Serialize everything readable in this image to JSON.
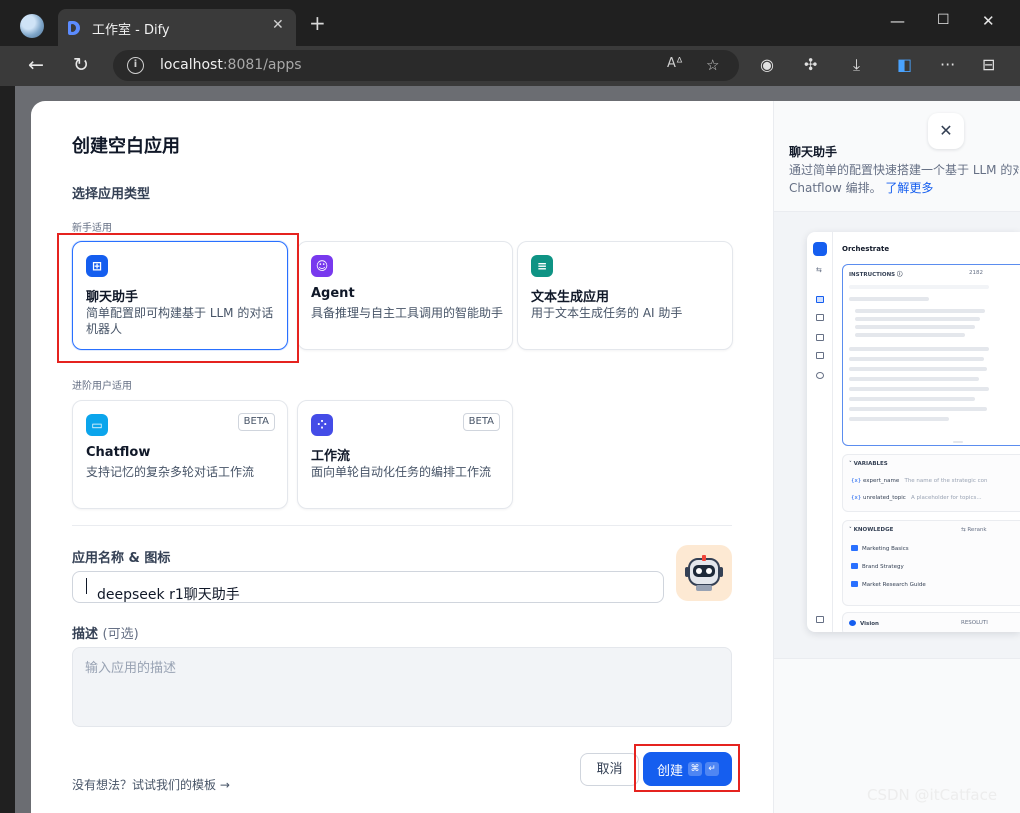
{
  "browser": {
    "tab_title": "工作室 - Dify",
    "tab_close": "✕",
    "new_tab": "+",
    "url_host": "localhost",
    "url_rest": ":8081/apps"
  },
  "modal": {
    "title": "创建空白应用",
    "section_type": "选择应用类型",
    "group_beginner": "新手适用",
    "group_advanced": "进阶用户适用",
    "app_types": [
      {
        "title": "聊天助手",
        "desc": "简单配置即可构建基于 LLM 的对话机器人",
        "icon_color": "#155eef",
        "selected": true
      },
      {
        "title": "Agent",
        "desc": "具备推理与自主工具调用的智能助手",
        "icon_color": "#7839ee",
        "selected": false
      },
      {
        "title": "文本生成应用",
        "desc": "用于文本生成任务的 AI 助手",
        "icon_color": "#0e9384",
        "selected": false
      },
      {
        "title": "Chatflow",
        "desc": "支持记忆的复杂多轮对话工作流",
        "icon_color": "#0ba5ec",
        "badge": "BETA",
        "selected": false
      },
      {
        "title": "工作流",
        "desc": "面向单轮自动化任务的编排工作流",
        "icon_color": "#444ce7",
        "badge": "BETA",
        "selected": false
      }
    ],
    "name_label": "应用名称 & 图标",
    "name_value": "deepseek r1聊天助手",
    "desc_label": "描述",
    "desc_optional": "(可选)",
    "desc_placeholder": "输入应用的描述",
    "template_link": "没有想法？试试我们的模板 →",
    "cancel_label": "取消",
    "create_label": "创建",
    "create_kbd_1": "⌘",
    "create_kbd_2": "↵"
  },
  "preview": {
    "title": "聊天助手",
    "desc": "通过简单的配置快速搭建一个基于 LLM 的对话机器人",
    "desc_line2": "Chatflow 编排。",
    "learn_more": "了解更多",
    "close": "✕",
    "mini": {
      "title": "Orchestrate",
      "instructions": "INSTRUCTIONS ⓘ",
      "count": "2182",
      "variables": "VARIABLES",
      "var1_name": "expert_name",
      "var1_desc": "The name of the strategic con",
      "var2_name": "unrelated_topic",
      "var2_desc": "A placeholder for topics...",
      "knowledge": "KNOWLEDGE",
      "rerank": "⇆ Rerank",
      "k1": "Marketing Basics",
      "k2": "Brand Strategy",
      "k3": "Market Research Guide",
      "vision": "Vision",
      "resolution": "RESOLUTI"
    }
  },
  "watermark": "CSDN @itCatface"
}
